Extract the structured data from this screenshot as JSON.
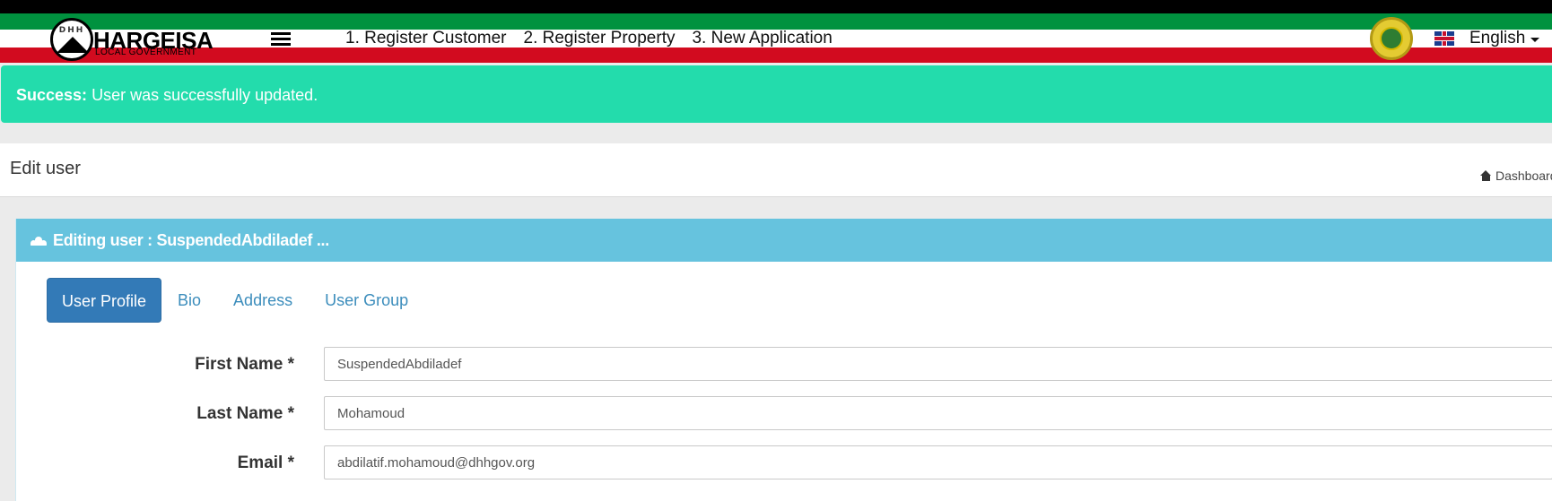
{
  "navbar": {
    "brand_title": "HARGEISA",
    "brand_subtitle": "LOCAL GOVERNMENT",
    "logo_letters": "DHH",
    "links": [
      "1. Register Customer",
      "2. Register Property",
      "3. New Application"
    ],
    "language": "English",
    "colors": {
      "black": "#000000",
      "green": "#00923f",
      "white": "#ffffff",
      "red": "#d20b1f"
    }
  },
  "alert": {
    "label": "Success:",
    "message": "User was successfully updated.",
    "color": "#23dcac"
  },
  "page_header": {
    "title": "Edit user",
    "breadcrumb": "Dashboard"
  },
  "box": {
    "title": "Editing user : SuspendedAbdiladef ...",
    "header_color": "#66c3de",
    "tabs": [
      "User Profile",
      "Bio",
      "Address",
      "User Group"
    ],
    "active_tab": "User Profile"
  },
  "form": {
    "first_name": {
      "label": "First Name *",
      "value": "SuspendedAbdiladef"
    },
    "last_name": {
      "label": "Last Name *",
      "value": "Mohamoud"
    },
    "email": {
      "label": "Email *",
      "value": "abdilatif.mohamoud@dhhgov.org"
    }
  }
}
